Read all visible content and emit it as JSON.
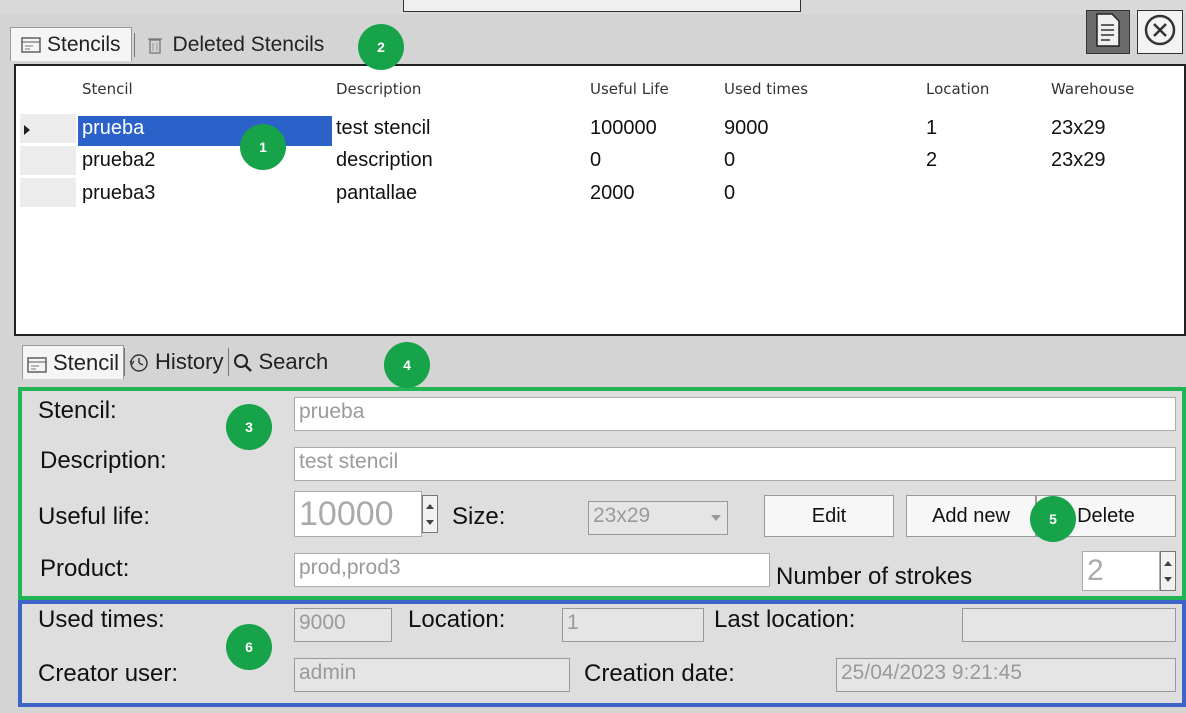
{
  "top_tabs": [
    {
      "label": "Stencils",
      "icon": "stencil-icon"
    },
    {
      "label": "Deleted Stencils",
      "icon": "trash-icon"
    }
  ],
  "toolbar": {
    "export_icon": "document-icon",
    "close_icon": "close-icon"
  },
  "grid": {
    "columns": [
      "Stencil",
      "Description",
      "Useful Life",
      "Used times",
      "Location",
      "Warehouse"
    ],
    "rows": [
      {
        "stencil": "prueba",
        "description": "test stencil",
        "useful_life": "100000",
        "used_times": "9000",
        "location": "1",
        "warehouse": "23x29"
      },
      {
        "stencil": "prueba2",
        "description": "description",
        "useful_life": "0",
        "used_times": "0",
        "location": "2",
        "warehouse": "23x29"
      },
      {
        "stencil": "prueba3",
        "description": "pantallae",
        "useful_life": "2000",
        "used_times": "0",
        "location": "",
        "warehouse": ""
      }
    ],
    "selected_row": 0
  },
  "detail_tabs": [
    {
      "label": "Stencil",
      "icon": "stencil-icon"
    },
    {
      "label": "History",
      "icon": "history-icon"
    },
    {
      "label": "Search",
      "icon": "search-icon"
    }
  ],
  "form": {
    "stencil_label": "Stencil:",
    "stencil_value": "prueba",
    "description_label": "Description:",
    "description_value": "test stencil",
    "useful_life_label": "Useful life:",
    "useful_life_value": "10000",
    "size_label": "Size:",
    "size_value": "23x29",
    "edit_label": "Edit",
    "add_new_label": "Add new",
    "delete_label": "Delete",
    "product_label": "Product:",
    "product_value": "prod,prod3",
    "strokes_label": "Number of strokes",
    "strokes_value": "2"
  },
  "info": {
    "used_times_label": "Used times:",
    "used_times_value": "9000",
    "location_label": "Location:",
    "location_value": "1",
    "last_location_label": "Last location:",
    "last_location_value": "",
    "creator_label": "Creator user:",
    "creator_value": "admin",
    "creation_date_label": "Creation date:",
    "creation_date_value": "25/04/2023 9:21:45"
  },
  "badges": [
    "1",
    "2",
    "3",
    "4",
    "5",
    "6"
  ],
  "colors": {
    "selection": "#2a62c9",
    "green_frame": "#22b455",
    "blue_frame": "#3e64c8",
    "badge": "#16a34a"
  }
}
